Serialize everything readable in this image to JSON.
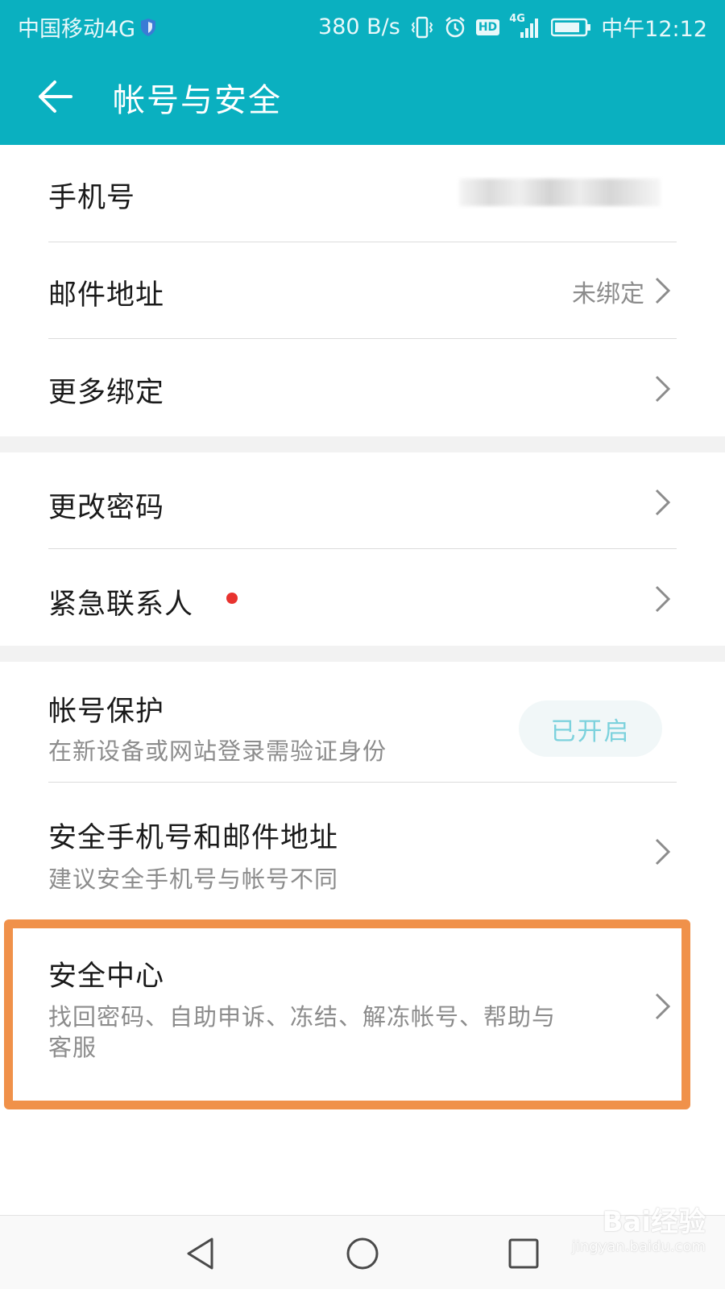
{
  "status_bar": {
    "carrier": "中国移动4G",
    "net_speed": "380 B/s",
    "hd_badge": "HD",
    "network": "4G",
    "time": "中午12:12",
    "icons": [
      "shield-icon",
      "vibrate-icon",
      "alarm-icon",
      "hd-icon",
      "signal-icon",
      "battery-icon"
    ]
  },
  "app_bar": {
    "title": "帐号与安全",
    "back_icon": "arrow-left-icon"
  },
  "section1": {
    "phone": {
      "label": "手机号",
      "value_obscured": true
    },
    "email": {
      "label": "邮件地址",
      "value": "未绑定"
    },
    "more_binding": {
      "label": "更多绑定"
    }
  },
  "section2": {
    "change_password": {
      "label": "更改密码"
    },
    "emergency_contact": {
      "label": "紧急联系人",
      "badge": "red-dot"
    }
  },
  "section3": {
    "account_protection": {
      "label": "帐号保护",
      "subtitle": "在新设备或网站登录需验证身份",
      "status": "已开启"
    },
    "security_phone_email": {
      "label": "安全手机号和邮件地址",
      "subtitle": "建议安全手机号与帐号不同"
    },
    "security_center": {
      "label": "安全中心",
      "subtitle_line1": "找回密码、自助申诉、冻结、解冻帐号、帮助与",
      "subtitle_line2": "客服"
    }
  },
  "highlight_color": "#f0914a",
  "accent_color": "#0ab0c0",
  "nav_bar": {
    "icons": [
      "nav-back-icon",
      "nav-home-icon",
      "nav-recents-icon"
    ]
  },
  "watermark": {
    "brand": "Bai经验",
    "url": "jingyan.baidu.com"
  }
}
